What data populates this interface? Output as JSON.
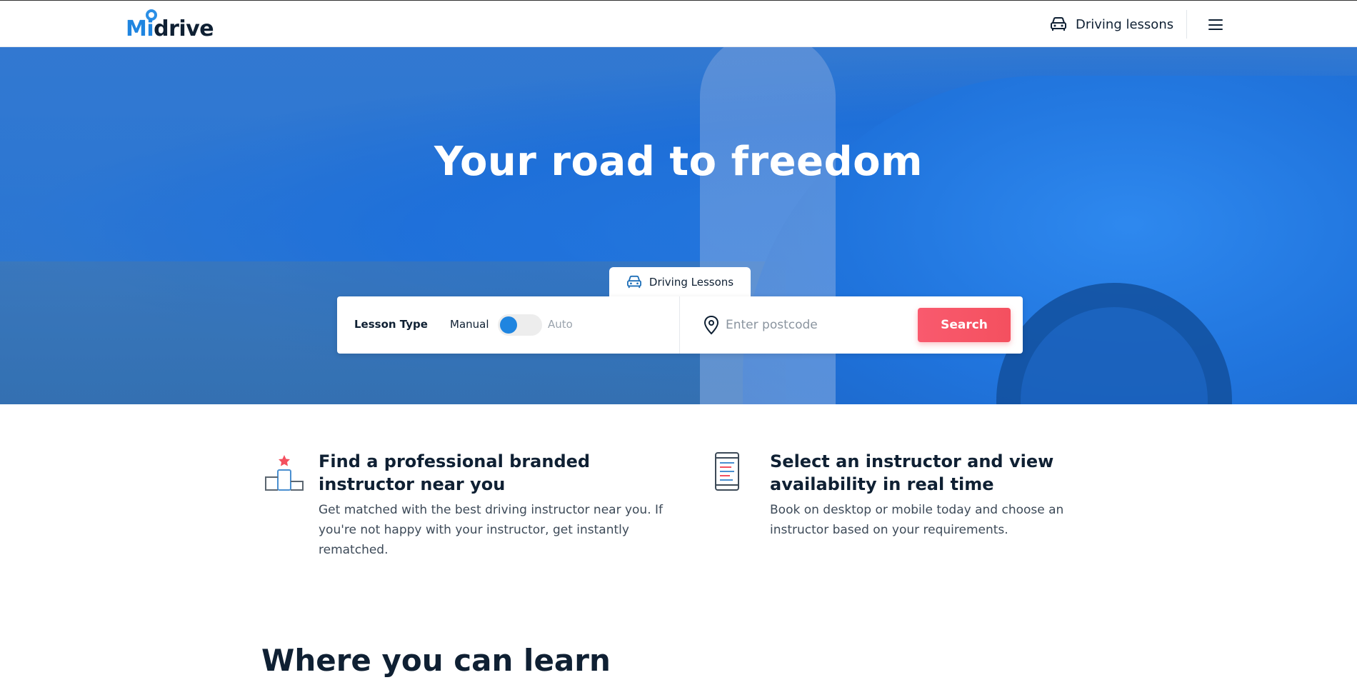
{
  "header": {
    "logo": {
      "first": "Mi",
      "rest": "drive",
      "icon": "location-pin-logo"
    },
    "nav_lessons_label": "Driving lessons",
    "nav_lessons_icon": "car-icon",
    "menu_icon": "hamburger-menu-icon"
  },
  "hero": {
    "title": "Your road to freedom",
    "tab_label": "Driving Lessons",
    "tab_icon": "car-icon",
    "search": {
      "lesson_type_label": "Lesson Type",
      "option_manual": "Manual",
      "option_auto": "Auto",
      "selected": "Manual",
      "postcode_placeholder": "Enter postcode",
      "postcode_value": "",
      "search_button_label": "Search"
    }
  },
  "features": [
    {
      "icon": "podium-star-icon",
      "title": "Find a professional branded instructor near you",
      "text": "Get matched with the best driving instructor near you. If you're not happy with your instructor, get instantly rematched."
    },
    {
      "icon": "mobile-schedule-icon",
      "title": "Select an instructor and view availability in real time",
      "text": "Book on desktop or mobile today and choose an instructor based on your requirements."
    }
  ],
  "section_title": "Where you can learn",
  "colors": {
    "brand_blue": "#1f85e0",
    "accent_red": "#f4505f",
    "text_dark": "#0f2033"
  }
}
